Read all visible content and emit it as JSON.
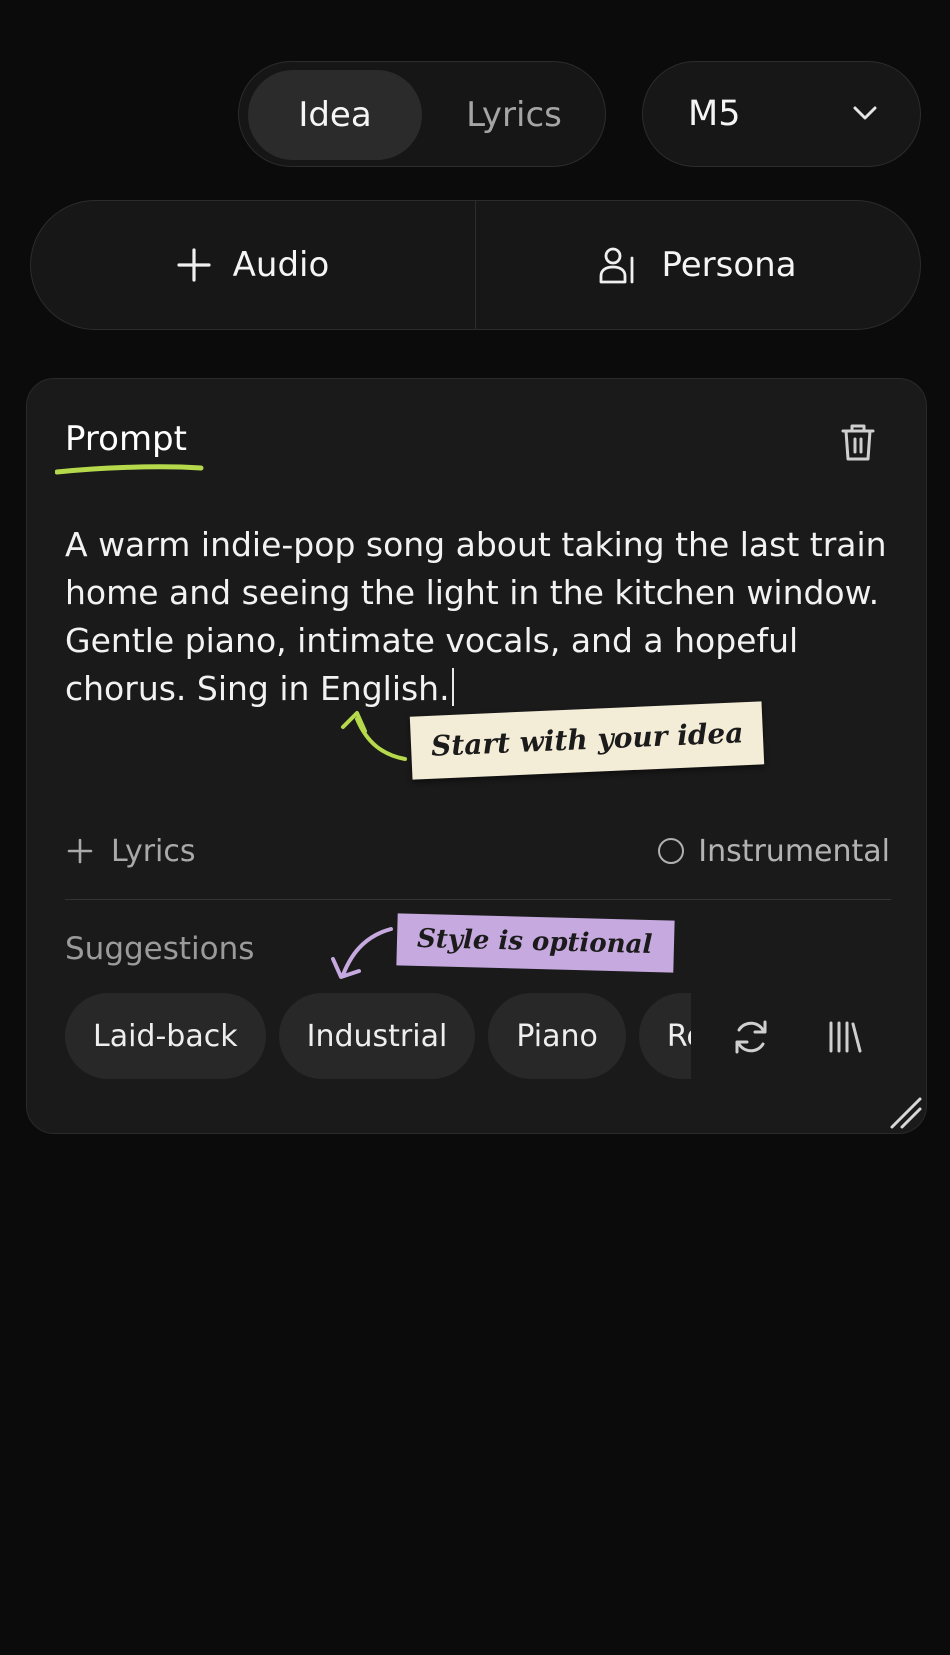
{
  "mode_toggle": {
    "tabs": [
      "Idea",
      "Lyrics"
    ],
    "active": "Idea"
  },
  "model_select": {
    "value": "M5",
    "icon": "chevron-down-icon"
  },
  "actions": {
    "audio_label": "Audio",
    "audio_icon": "plus-icon",
    "persona_label": "Persona",
    "persona_icon": "persona-icon"
  },
  "prompt_card": {
    "title": "Prompt",
    "delete_icon": "trash-icon",
    "text": "A warm indie-pop song about taking the last train home and seeing the light in the kitchen window. Gentle piano, intimate vocals, and a hopeful chorus. Sing in English.",
    "hint_idea": "Start with your idea",
    "add_lyrics_label": "Lyrics",
    "instrumental_label": "Instrumental",
    "instrumental_checked": false,
    "suggestions_label": "Suggestions",
    "hint_style": "Style is optional",
    "suggestions": [
      "Laid-back",
      "Industrial",
      "Piano",
      "Rec"
    ],
    "refresh_icon": "refresh-icon",
    "library_icon": "library-icon"
  },
  "colors": {
    "background": "#0b0b0b",
    "surface": "#1a1a1a",
    "accent_green": "#b6d94c",
    "note_cream": "#f3ecd6",
    "note_purple": "#c5a9df"
  }
}
